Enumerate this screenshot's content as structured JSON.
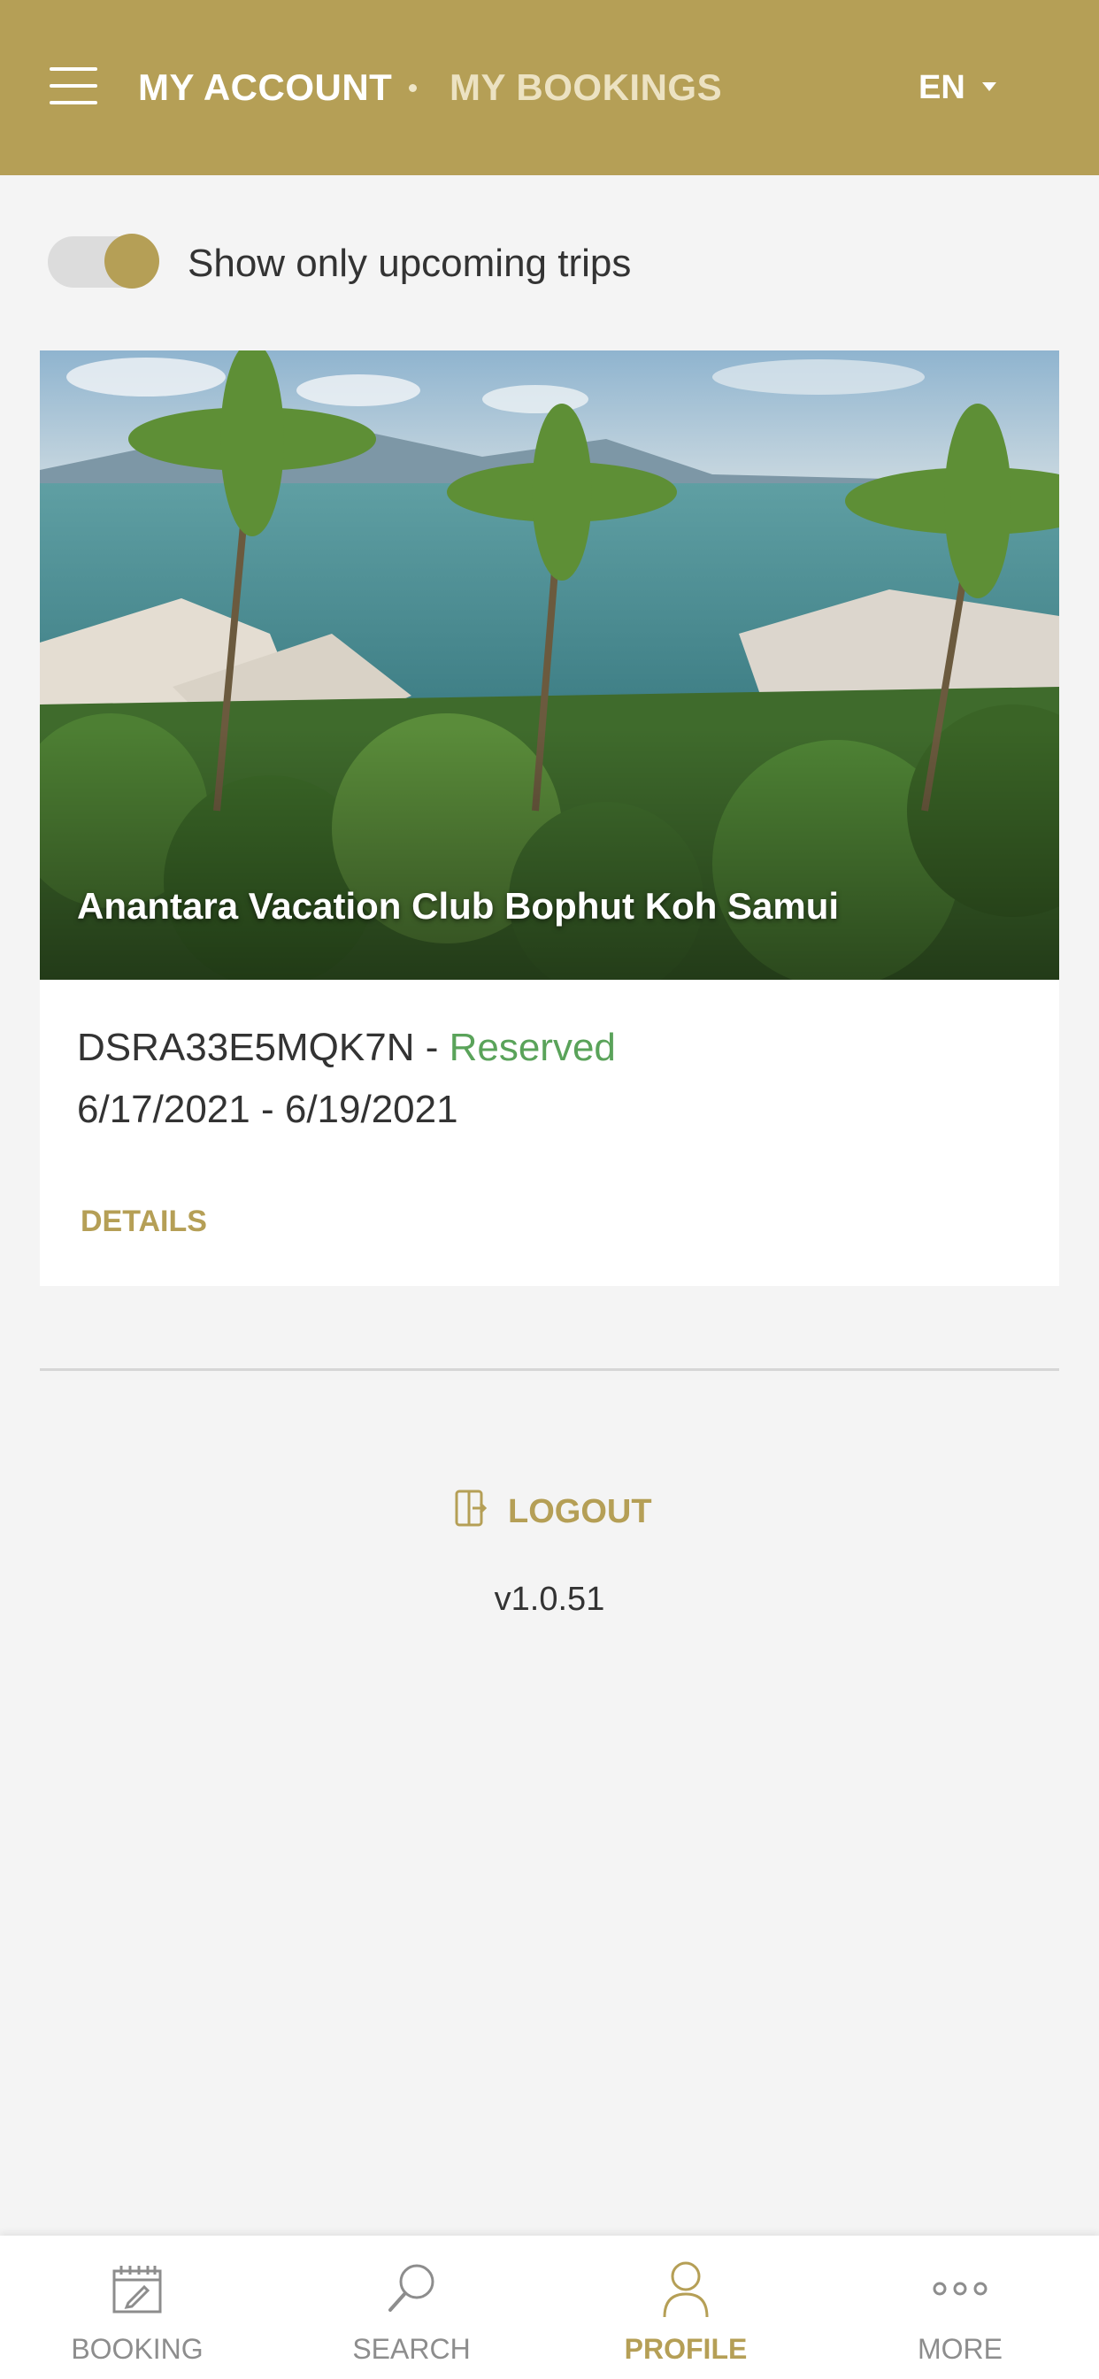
{
  "header": {
    "title": "MY ACCOUNT",
    "subtitle": "MY BOOKINGS",
    "language": "EN"
  },
  "filter": {
    "toggle_label": "Show only upcoming trips",
    "toggle_on": true
  },
  "booking": {
    "resort_name": "Anantara Vacation Club Bophut Koh Samui",
    "code": "DSRA33E5MQK7N",
    "separator": " - ",
    "status": "Reserved",
    "dates": "6/17/2021 - 6/19/2021",
    "details_label": "DETAILS"
  },
  "footer": {
    "logout_label": "LOGOUT",
    "version": "v1.0.51"
  },
  "tabs": [
    {
      "label": "BOOKING",
      "icon": "calendar-edit-icon"
    },
    {
      "label": "SEARCH",
      "icon": "search-icon"
    },
    {
      "label": "PROFILE",
      "icon": "user-icon",
      "active": true
    },
    {
      "label": "MORE",
      "icon": "more-dots-icon"
    }
  ],
  "colors": {
    "brand_gold": "#b59f56",
    "status_reserved": "#5aa35a",
    "background": "#f4f4f4"
  }
}
